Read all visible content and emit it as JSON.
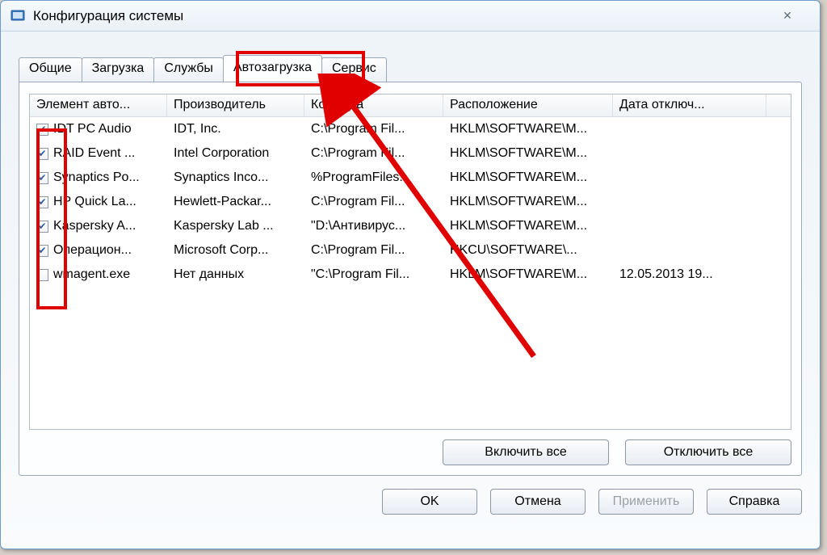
{
  "window": {
    "title": "Конфигурация системы"
  },
  "tabs": {
    "general": "Общие",
    "boot": "Загрузка",
    "services": "Службы",
    "startup": "Автозагрузка",
    "tools": "Сервис"
  },
  "columns": {
    "item": "Элемент авто...",
    "manufacturer": "Производитель",
    "command": "Команда",
    "location": "Расположение",
    "date": "Дата отключ..."
  },
  "rows": [
    {
      "checked": true,
      "item": "IDT PC Audio",
      "man": "IDT, Inc.",
      "cmd": "C:\\Program Fil...",
      "loc": "HKLM\\SOFTWARE\\M...",
      "date": ""
    },
    {
      "checked": true,
      "item": "RAID Event ...",
      "man": "Intel Corporation",
      "cmd": "C:\\Program Fil...",
      "loc": "HKLM\\SOFTWARE\\M...",
      "date": ""
    },
    {
      "checked": true,
      "item": "Synaptics Po...",
      "man": "Synaptics Inco...",
      "cmd": "%ProgramFiles...",
      "loc": "HKLM\\SOFTWARE\\M...",
      "date": ""
    },
    {
      "checked": true,
      "item": "HP Quick La...",
      "man": "Hewlett-Packar...",
      "cmd": "C:\\Program Fil...",
      "loc": "HKLM\\SOFTWARE\\M...",
      "date": ""
    },
    {
      "checked": true,
      "item": "Kaspersky A...",
      "man": "Kaspersky Lab ...",
      "cmd": "\"D:\\Антивирус...",
      "loc": "HKLM\\SOFTWARE\\M...",
      "date": ""
    },
    {
      "checked": true,
      "item": "Операцион...",
      "man": "Microsoft Corp...",
      "cmd": "C:\\Program Fil...",
      "loc": "HKCU\\SOFTWARE\\...",
      "date": ""
    },
    {
      "checked": false,
      "item": "wmagent.exe",
      "man": "Нет данных",
      "cmd": "\"C:\\Program Fil...",
      "loc": "HKLM\\SOFTWARE\\M...",
      "date": "12.05.2013 19..."
    }
  ],
  "panel_buttons": {
    "enable_all": "Включить все",
    "disable_all": "Отключить все"
  },
  "dialog_buttons": {
    "ok": "OK",
    "cancel": "Отмена",
    "apply": "Применить",
    "help": "Справка"
  }
}
